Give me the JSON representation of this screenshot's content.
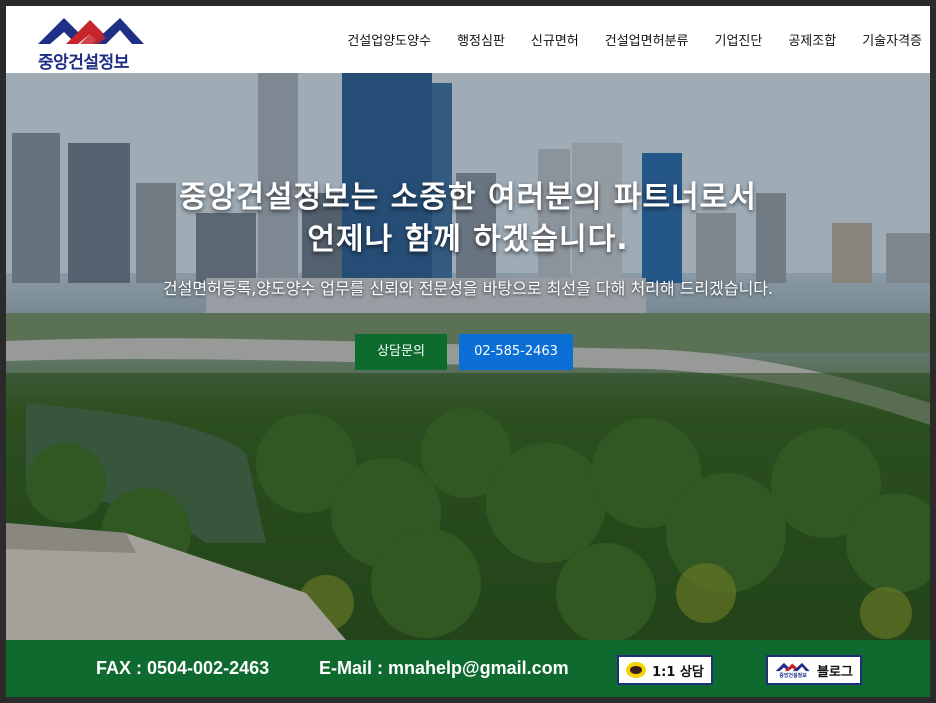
{
  "brand": {
    "name": "중앙건설정보",
    "colors": {
      "navy": "#1f2f86",
      "red": "#c8242b",
      "green": "#0f6a30",
      "blue": "#0b6fd6"
    }
  },
  "nav": {
    "items": [
      {
        "label": "건설업양도양수"
      },
      {
        "label": "행정심판"
      },
      {
        "label": "신규면허"
      },
      {
        "label": "건설업면허분류"
      },
      {
        "label": "기업진단"
      },
      {
        "label": "공제조합"
      },
      {
        "label": "기술자격증"
      }
    ]
  },
  "hero": {
    "title_line1": "중앙건설정보는 소중한 여러분의 파트너로서",
    "title_line2": "언제나 함께 하겠습니다.",
    "subtitle": "건설면허등록,양도양수 업무를 신뢰와 전문성을 바탕으로 최선을 다해 처리해 드리겠습니다.",
    "consult_button": "상담문의",
    "phone_button": "02-585-2463"
  },
  "footer": {
    "fax": "FAX : 0504-002-2463",
    "email": "E-Mail : mnahelp@gmail.com",
    "chat_button": "1:1 상담",
    "blog_button": "블로그",
    "blog_logo_text": "중앙건설정보"
  }
}
